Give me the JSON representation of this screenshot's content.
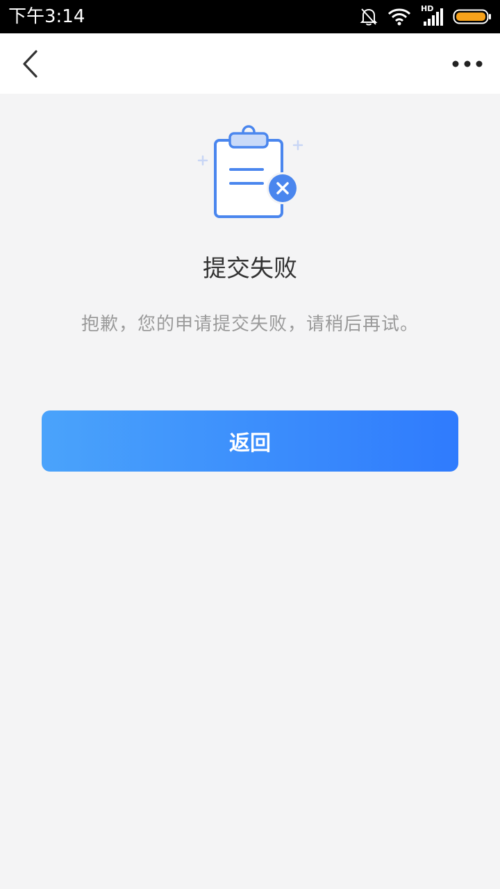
{
  "status_bar": {
    "time": "下午3:14",
    "network_label": "HD",
    "battery_color": "#f7a21b"
  },
  "nav": {
    "back_icon": "chevron-left-icon",
    "more_icon": "more-dots-icon"
  },
  "result": {
    "icon": "clipboard-error-icon",
    "title": "提交失败",
    "description": "抱歉，您的申请提交失败，请稍后再试。"
  },
  "actions": {
    "return_label": "返回"
  },
  "colors": {
    "accent_start": "#4aa3fb",
    "accent_end": "#2f7bfd",
    "icon_blue": "#4a86ee"
  }
}
